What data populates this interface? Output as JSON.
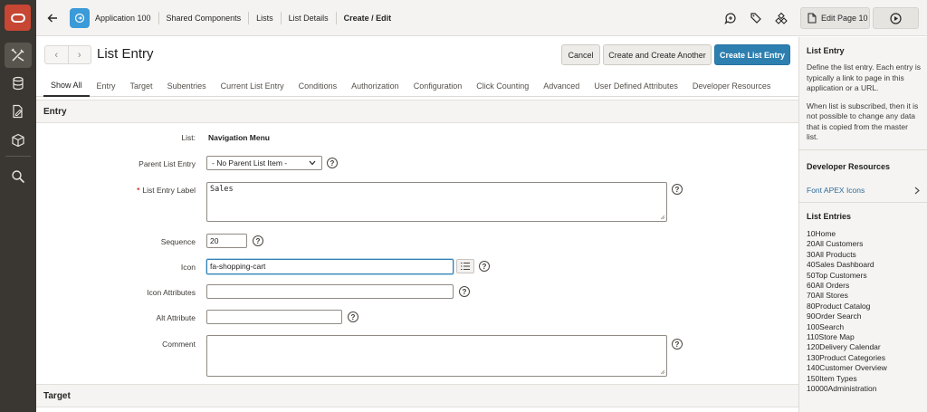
{
  "colors": {
    "accent": "#2d7fb0",
    "brand": "#c74634",
    "rail": "#3a3631"
  },
  "rail": {
    "icons": [
      "oracle-logo-icon",
      "tools-icon",
      "database-icon",
      "page-edit-icon",
      "package-icon",
      "search-icon"
    ]
  },
  "topbar": {
    "breadcrumbs": [
      "Application 100",
      "Shared Components",
      "Lists",
      "List Details",
      "Create / Edit"
    ],
    "edit_page_label": "Edit Page 10"
  },
  "page": {
    "title": "List Entry",
    "buttons": {
      "cancel": "Cancel",
      "create_another": "Create and Create Another",
      "create": "Create List Entry"
    }
  },
  "tabs": [
    "Show All",
    "Entry",
    "Target",
    "Subentries",
    "Current List Entry",
    "Conditions",
    "Authorization",
    "Configuration",
    "Click Counting",
    "Advanced",
    "User Defined Attributes",
    "Developer Resources"
  ],
  "entry": {
    "region_title": "Entry",
    "list_label": "List:",
    "list_value": "Navigation Menu",
    "parent_label": "Parent List Entry",
    "parent_value": "- No Parent List Item -",
    "entry_label_label": "List Entry Label",
    "entry_label_value": "Sales",
    "sequence_label": "Sequence",
    "sequence_value": "20",
    "icon_label": "Icon",
    "icon_value": "fa-shopping-cart",
    "icon_attr_label": "Icon Attributes",
    "icon_attr_value": "",
    "alt_label": "Alt Attribute",
    "alt_value": "",
    "comment_label": "Comment",
    "comment_value": "",
    "help_glyph": "?"
  },
  "target": {
    "region_title": "Target"
  },
  "right_panel": {
    "list_entry_title": "List Entry",
    "list_entry_text1": "Define the list entry. Each entry is typically a link to page in this application or a URL.",
    "list_entry_text2": "When list is subscribed, then it is not possible to change any data that is copied from the master list.",
    "dev_resources_title": "Developer Resources",
    "dev_link": "Font APEX Icons",
    "list_entries_title": "List Entries",
    "list_entries": [
      "10Home",
      "20All Customers",
      "30All Products",
      "40Sales Dashboard",
      "50Top Customers",
      "60All Orders",
      "70All Stores",
      "80Product Catalog",
      "90Order Search",
      "100Search",
      "110Store Map",
      "120Delivery Calendar",
      "130Product Categories",
      "140Customer Overview",
      "150Item Types",
      "10000Administration"
    ]
  }
}
